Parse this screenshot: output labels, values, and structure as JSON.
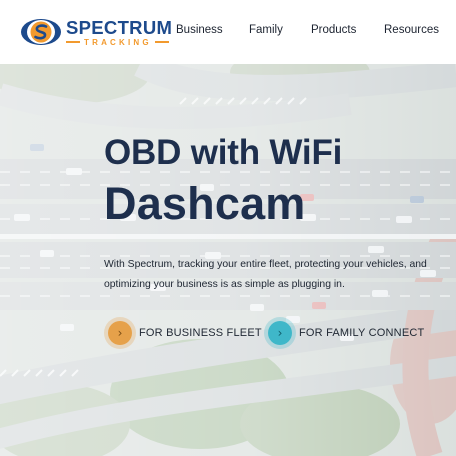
{
  "brand": {
    "name": "SPECTRUM",
    "tagline": "TRACKING",
    "colors": {
      "navy": "#1d4a8c",
      "orange": "#f29a2e"
    }
  },
  "nav": {
    "items": [
      {
        "label": "Business"
      },
      {
        "label": "Family"
      },
      {
        "label": "Products"
      },
      {
        "label": "Resources"
      }
    ]
  },
  "hero": {
    "title_line1": "OBD with WiFi",
    "title_line2": "Dashcam",
    "description": "With Spectrum, tracking your entire fleet, protecting your vehicles, and optimizing your business is as simple as plugging in.",
    "background": "aerial-highway-interchange-photo",
    "ctas": [
      {
        "label": "FOR BUSINESS FLEET",
        "icon": "chevron-right-icon",
        "color": "#e6a14a"
      },
      {
        "label": "FOR FAMILY CONNECT",
        "icon": "chevron-right-icon",
        "color": "#3fb8c9"
      }
    ]
  }
}
